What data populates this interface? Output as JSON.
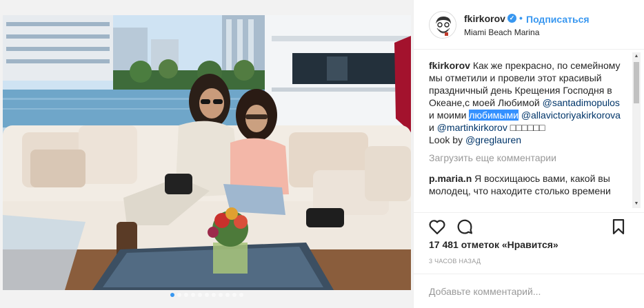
{
  "header": {
    "username": "fkirkorov",
    "verified_mark": "✓",
    "separator": "•",
    "follow_label": "Подписаться",
    "location": "Miami Beach Marina"
  },
  "caption": {
    "user": "fkirkorov",
    "text_1": "Как же прекрасно, по семейному мы отметили и провели этот красивый праздничный день Крещения Господня в Океане,с моей Любимой",
    "mention_1": "@santadimopulos",
    "text_2": "и моими",
    "highlighted": "любимыми",
    "mention_2": "@allavictoriyakirkorova",
    "text_3": "и",
    "mention_3": "@martinkirkorov",
    "emoji_boxes": "□□□□□□",
    "look_by": "Look by",
    "mention_4": "@greglauren"
  },
  "load_more": "Загрузить еще комментарии",
  "comment": {
    "user": "p.maria.n",
    "text": "Я восхищаюсь вами, какой вы молодец, что находите столько времени"
  },
  "scrollbar": {
    "up": "▲",
    "down": "▼"
  },
  "actions": {
    "like_icon": "heart-icon",
    "comment_icon": "comment-icon",
    "save_icon": "bookmark-icon"
  },
  "likes": "17 481 отметок «Нравится»",
  "timestamp": "3 ЧАСОВ НАЗАД",
  "add_comment_placeholder": "Добавьте комментарий...",
  "carousel": {
    "count": 11,
    "active_index": 0
  },
  "colors": {
    "accent": "#3897f0",
    "mention": "#003569",
    "muted": "#999999",
    "border": "#efefef"
  }
}
